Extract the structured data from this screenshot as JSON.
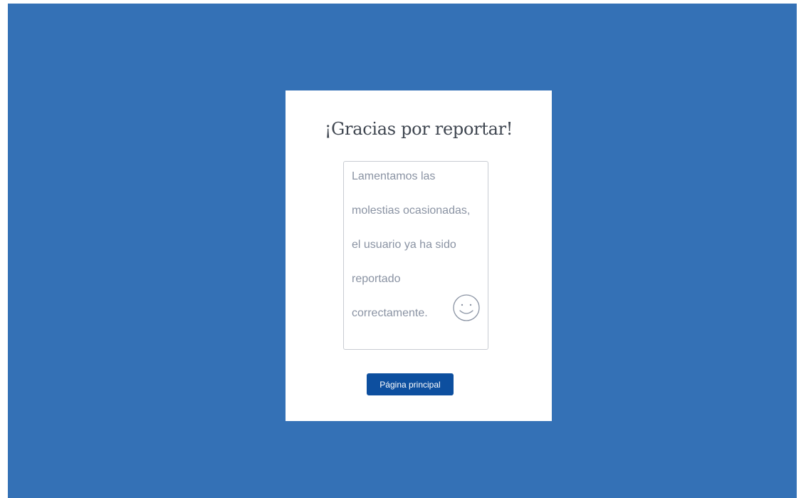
{
  "dialog": {
    "title": "¡Gracias por reportar!",
    "message_lines": [
      "Lamentamos las",
      "molestias ocasionadas,",
      "el usuario ya ha sido",
      "reportado",
      "correctamente."
    ],
    "icon": "smiley-face-icon",
    "button_label": "Página principal"
  },
  "colors": {
    "background": "#3471b6",
    "dialog": "#ffffff",
    "title_text": "#3f4650",
    "message_text": "#8a93a3",
    "button": "#0d4f9f",
    "button_text": "#ffffff"
  }
}
